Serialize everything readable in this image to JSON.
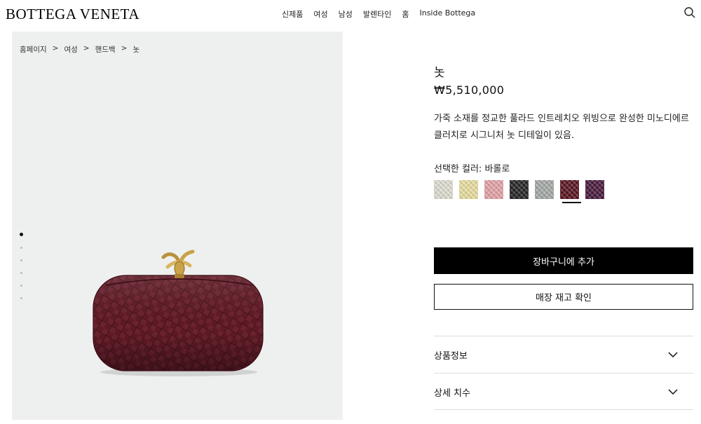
{
  "header": {
    "logo": "BOTTEGA VENETA",
    "nav": [
      "신제품",
      "여성",
      "남성",
      "발렌타인",
      "홈",
      "Inside Bottega"
    ],
    "search_icon": "search-icon"
  },
  "breadcrumb": [
    "홈페이지",
    "여성",
    "핸드백",
    "놋"
  ],
  "breadcrumb_separator": ">",
  "gallery": {
    "total_images": 6,
    "active_index": 0
  },
  "product": {
    "name": "놋",
    "price": "₩5,510,000",
    "description": "가죽 소재를 정교한 풀라드 인트레치오 위빙으로 완성한 미노디에르 클러치로 시그니처 놋 디테일이 있음.",
    "color_label": "선택한 컬러: 바롤로",
    "swatches": [
      {
        "color": "#e4e2d6"
      },
      {
        "color": "#eee2a3"
      },
      {
        "color": "#e9a6aa"
      },
      {
        "color": "#262626"
      },
      {
        "color": "#a9ada9"
      },
      {
        "color": "#5b1420"
      },
      {
        "color": "#4a1a3e"
      }
    ],
    "selected_swatch": 5
  },
  "actions": {
    "add_to_cart": "장바구니에 추가",
    "check_store": "매장 재고 확인"
  },
  "accordion": [
    "상품정보",
    "상세 치수"
  ],
  "colors": {
    "bag": "#5e1a24",
    "gallery_bg": "#eef0ef",
    "knot": "#c9a24a"
  }
}
